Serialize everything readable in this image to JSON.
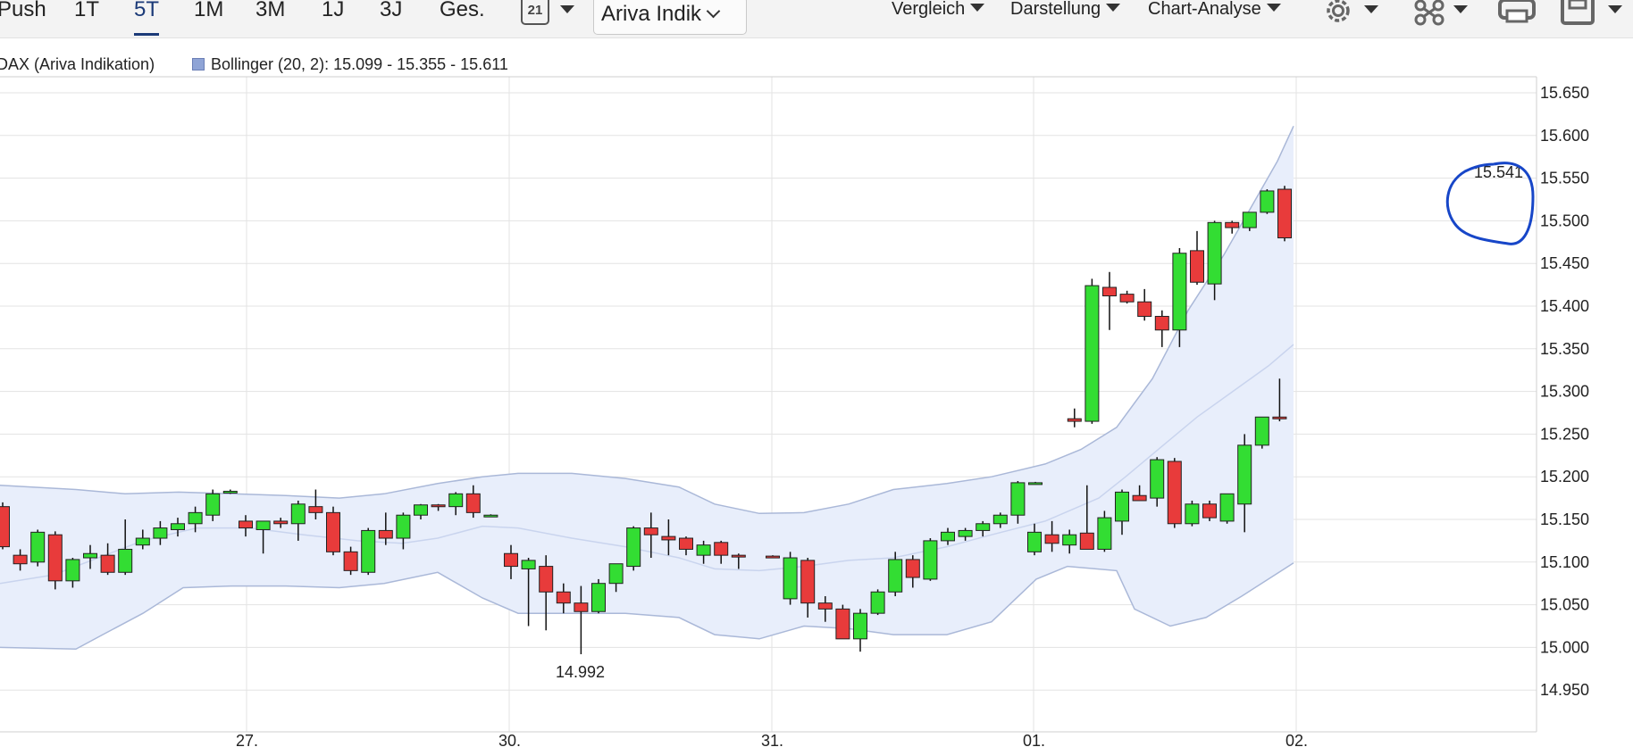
{
  "toolbar": {
    "periods": [
      "Push",
      "1T",
      "5T",
      "1M",
      "3M",
      "1J",
      "3J",
      "Ges."
    ],
    "active_period": "5T",
    "calendar_icon_text": "21",
    "exchange_select": "Ariva Indik",
    "menus": [
      "Vergleich",
      "Darstellung",
      "Chart-Analyse"
    ],
    "icons": [
      "gear-icon",
      "share-icon",
      "print-icon",
      "save-icon"
    ]
  },
  "legend": {
    "instrument": "DAX (Ariva Indikation)",
    "indicator": "Bollinger (20, 2): 15.099 - 15.355 - 15.611"
  },
  "chart_data": {
    "type": "candlestick",
    "title": "",
    "ylim": [
      14.92,
      15.67
    ],
    "y_ticks": [
      "15.650",
      "15.600",
      "15.550",
      "15.500",
      "15.450",
      "15.400",
      "15.350",
      "15.300",
      "15.250",
      "15.200",
      "15.150",
      "15.100",
      "15.050",
      "15.000",
      "14.950"
    ],
    "x_labels": [
      "27.",
      "30.",
      "31.",
      "01.",
      "02."
    ],
    "annotations": {
      "low_label": "14.992",
      "high_label": "15.541"
    },
    "colors": {
      "up": "#33dd33",
      "down": "#e83b3b",
      "band": "#e8eefb",
      "band_line": "#aab8d8",
      "grid": "#e3e3e3"
    },
    "candles": [
      [
        15.165,
        15.17,
        15.115,
        15.118
      ],
      [
        15.108,
        15.115,
        15.09,
        15.098
      ],
      [
        15.1,
        15.138,
        15.095,
        15.135
      ],
      [
        15.132,
        15.136,
        15.068,
        15.078
      ],
      [
        15.078,
        15.105,
        15.07,
        15.103
      ],
      [
        15.105,
        15.12,
        15.092,
        15.11
      ],
      [
        15.108,
        15.122,
        15.085,
        15.088
      ],
      [
        15.088,
        15.15,
        15.085,
        15.115
      ],
      [
        15.12,
        15.138,
        15.115,
        15.128
      ],
      [
        15.128,
        15.148,
        15.12,
        15.14
      ],
      [
        15.138,
        15.152,
        15.13,
        15.145
      ],
      [
        15.145,
        15.165,
        15.135,
        15.158
      ],
      [
        15.155,
        15.185,
        15.148,
        15.18
      ],
      [
        15.182,
        15.185,
        15.18,
        15.183
      ],
      [
        15.148,
        15.155,
        15.13,
        15.14
      ],
      [
        15.138,
        15.148,
        15.11,
        15.148
      ],
      [
        15.148,
        15.152,
        15.14,
        15.145
      ],
      [
        15.145,
        15.172,
        15.125,
        15.168
      ],
      [
        15.165,
        15.185,
        15.15,
        15.158
      ],
      [
        15.158,
        15.165,
        15.108,
        15.112
      ],
      [
        15.112,
        15.118,
        15.085,
        15.09
      ],
      [
        15.088,
        15.14,
        15.085,
        15.137
      ],
      [
        15.137,
        15.158,
        15.12,
        15.128
      ],
      [
        15.128,
        15.158,
        15.115,
        15.155
      ],
      [
        15.155,
        15.168,
        15.15,
        15.167
      ],
      [
        15.167,
        15.168,
        15.16,
        15.165
      ],
      [
        15.165,
        15.182,
        15.155,
        15.18
      ],
      [
        15.18,
        15.19,
        15.152,
        15.158
      ],
      [
        15.155,
        15.156,
        15.154,
        15.155
      ],
      [
        15.11,
        15.12,
        15.08,
        15.095
      ],
      [
        15.092,
        15.105,
        15.025,
        15.102
      ],
      [
        15.095,
        15.108,
        15.02,
        15.065
      ],
      [
        15.065,
        15.075,
        15.04,
        15.052
      ],
      [
        15.052,
        15.072,
        14.992,
        15.042
      ],
      [
        15.042,
        15.08,
        15.04,
        15.075
      ],
      [
        15.075,
        15.098,
        15.065,
        15.098
      ],
      [
        15.095,
        15.142,
        15.09,
        15.14
      ],
      [
        15.14,
        15.158,
        15.105,
        15.132
      ],
      [
        15.13,
        15.15,
        15.108,
        15.126
      ],
      [
        15.128,
        15.13,
        15.108,
        15.115
      ],
      [
        15.108,
        15.125,
        15.098,
        15.12
      ],
      [
        15.123,
        15.125,
        15.098,
        15.108
      ],
      [
        15.108,
        15.11,
        15.092,
        15.107
      ],
      [
        15.107,
        15.108,
        15.106,
        15.106
      ],
      [
        15.057,
        15.112,
        15.05,
        15.105
      ],
      [
        15.102,
        15.105,
        15.035,
        15.052
      ],
      [
        15.052,
        15.06,
        15.03,
        15.045
      ],
      [
        15.045,
        15.05,
        15.012,
        15.01
      ],
      [
        15.01,
        15.045,
        14.995,
        15.04
      ],
      [
        15.04,
        15.068,
        15.038,
        15.065
      ],
      [
        15.065,
        15.112,
        15.06,
        15.103
      ],
      [
        15.103,
        15.108,
        15.07,
        15.082
      ],
      [
        15.08,
        15.128,
        15.078,
        15.125
      ],
      [
        15.125,
        15.14,
        15.12,
        15.135
      ],
      [
        15.13,
        15.14,
        15.125,
        15.137
      ],
      [
        15.137,
        15.148,
        15.13,
        15.145
      ],
      [
        15.145,
        15.158,
        15.14,
        15.155
      ],
      [
        15.155,
        15.195,
        15.145,
        15.193
      ],
      [
        15.193,
        15.194,
        15.192,
        15.193
      ],
      [
        15.112,
        15.145,
        15.108,
        15.135
      ],
      [
        15.132,
        15.148,
        15.112,
        15.122
      ],
      [
        15.12,
        15.138,
        15.11,
        15.132
      ],
      [
        15.134,
        15.19,
        15.12,
        15.115
      ],
      [
        15.115,
        15.16,
        15.112,
        15.152
      ],
      [
        15.148,
        15.185,
        15.132,
        15.182
      ],
      [
        15.178,
        15.19,
        15.175,
        15.172
      ],
      [
        15.175,
        15.223,
        15.165,
        15.22
      ],
      [
        15.218,
        15.222,
        15.14,
        15.145
      ],
      [
        15.145,
        15.172,
        15.142,
        15.168
      ],
      [
        15.168,
        15.172,
        15.148,
        15.152
      ],
      [
        15.148,
        15.18,
        15.145,
        15.18
      ],
      [
        15.168,
        15.25,
        15.135,
        15.237
      ],
      [
        15.237,
        15.27,
        15.233,
        15.27
      ],
      [
        15.27,
        15.315,
        15.265,
        15.269
      ],
      [
        15.268,
        15.28,
        15.258,
        15.265
      ],
      [
        15.265,
        15.432,
        15.262,
        15.424
      ],
      [
        15.422,
        15.44,
        15.372,
        15.412
      ],
      [
        15.414,
        15.418,
        15.403,
        15.405
      ],
      [
        15.405,
        15.42,
        15.383,
        15.388
      ],
      [
        15.388,
        15.395,
        15.352,
        15.372
      ],
      [
        15.372,
        15.468,
        15.352,
        15.462
      ],
      [
        15.465,
        15.488,
        15.425,
        15.428
      ],
      [
        15.426,
        15.5,
        15.407,
        15.498
      ],
      [
        15.498,
        15.5,
        15.485,
        15.492
      ],
      [
        15.492,
        15.51,
        15.488,
        15.51
      ],
      [
        15.51,
        15.537,
        15.508,
        15.535
      ],
      [
        15.537,
        15.541,
        15.476,
        15.48
      ]
    ],
    "bollinger": {
      "upper": [
        [
          0,
          15.19
        ],
        [
          85,
          15.185
        ],
        [
          140,
          15.18
        ],
        [
          200,
          15.182
        ],
        [
          260,
          15.18
        ],
        [
          320,
          15.178
        ],
        [
          380,
          15.175
        ],
        [
          430,
          15.18
        ],
        [
          490,
          15.192
        ],
        [
          540,
          15.2
        ],
        [
          580,
          15.204
        ],
        [
          640,
          15.204
        ],
        [
          700,
          15.198
        ],
        [
          760,
          15.188
        ],
        [
          800,
          15.168
        ],
        [
          850,
          15.157
        ],
        [
          900,
          15.158
        ],
        [
          950,
          15.168
        ],
        [
          1000,
          15.185
        ],
        [
          1060,
          15.192
        ],
        [
          1110,
          15.2
        ],
        [
          1170,
          15.215
        ],
        [
          1210,
          15.232
        ],
        [
          1250,
          15.258
        ],
        [
          1290,
          15.315
        ],
        [
          1330,
          15.395
        ],
        [
          1370,
          15.46
        ],
        [
          1400,
          15.515
        ],
        [
          1430,
          15.57
        ],
        [
          1448,
          15.611
        ]
      ],
      "middle": [
        [
          0,
          15.075
        ],
        [
          60,
          15.085
        ],
        [
          110,
          15.105
        ],
        [
          160,
          15.125
        ],
        [
          220,
          15.14
        ],
        [
          280,
          15.14
        ],
        [
          340,
          15.132
        ],
        [
          400,
          15.125
        ],
        [
          450,
          15.122
        ],
        [
          490,
          15.128
        ],
        [
          540,
          15.142
        ],
        [
          580,
          15.14
        ],
        [
          640,
          15.128
        ],
        [
          700,
          15.118
        ],
        [
          760,
          15.105
        ],
        [
          800,
          15.092
        ],
        [
          850,
          15.09
        ],
        [
          900,
          15.095
        ],
        [
          950,
          15.102
        ],
        [
          1000,
          15.105
        ],
        [
          1060,
          15.118
        ],
        [
          1110,
          15.132
        ],
        [
          1170,
          15.148
        ],
        [
          1230,
          15.175
        ],
        [
          1260,
          15.2
        ],
        [
          1300,
          15.235
        ],
        [
          1340,
          15.27
        ],
        [
          1380,
          15.3
        ],
        [
          1420,
          15.33
        ],
        [
          1448,
          15.355
        ]
      ],
      "lower": [
        [
          0,
          15.0
        ],
        [
          85,
          14.998
        ],
        [
          115,
          15.015
        ],
        [
          160,
          15.04
        ],
        [
          205,
          15.07
        ],
        [
          260,
          15.072
        ],
        [
          320,
          15.072
        ],
        [
          380,
          15.07
        ],
        [
          430,
          15.075
        ],
        [
          490,
          15.088
        ],
        [
          540,
          15.058
        ],
        [
          580,
          15.04
        ],
        [
          640,
          15.04
        ],
        [
          700,
          15.04
        ],
        [
          760,
          15.035
        ],
        [
          800,
          15.015
        ],
        [
          850,
          15.01
        ],
        [
          900,
          15.025
        ],
        [
          950,
          15.022
        ],
        [
          1000,
          15.015
        ],
        [
          1060,
          15.015
        ],
        [
          1110,
          15.03
        ],
        [
          1160,
          15.08
        ],
        [
          1195,
          15.095
        ],
        [
          1250,
          15.09
        ],
        [
          1270,
          15.045
        ],
        [
          1310,
          15.025
        ],
        [
          1350,
          15.035
        ],
        [
          1390,
          15.06
        ],
        [
          1448,
          15.099
        ]
      ]
    }
  }
}
